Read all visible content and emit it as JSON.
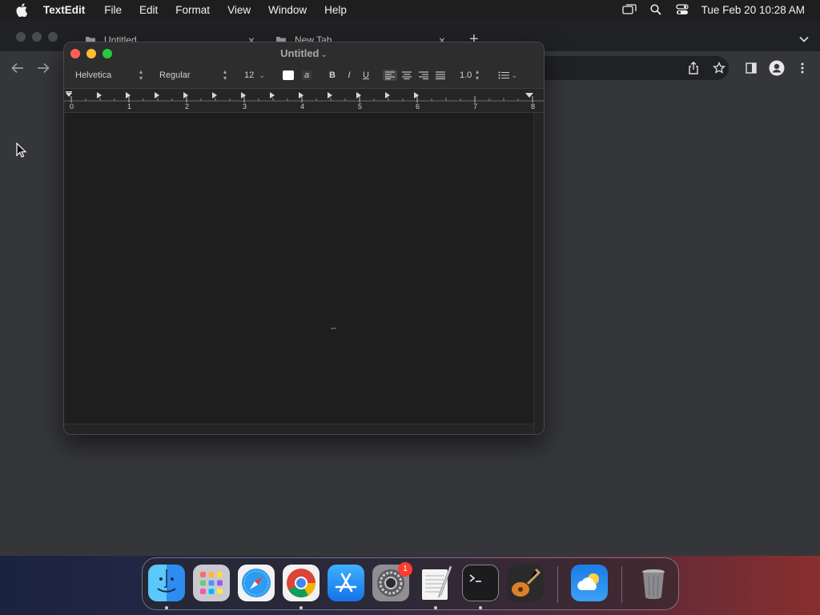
{
  "menubar": {
    "app_name": "TextEdit",
    "items": [
      "File",
      "Edit",
      "Format",
      "View",
      "Window",
      "Help"
    ],
    "clock": "Tue Feb 20  10:28 AM"
  },
  "browser": {
    "tabs": [
      {
        "label": "Untitled"
      },
      {
        "label": "New Tab"
      }
    ]
  },
  "textedit": {
    "title": "Untitled",
    "font_family": "Helvetica",
    "font_style": "Regular",
    "font_size": "12",
    "line_spacing": "1.0",
    "bold": "B",
    "italic": "I",
    "underline": "U",
    "text_color_glyph": "a",
    "ruler_numbers": [
      "0",
      "1",
      "2",
      "3",
      "4",
      "5",
      "6",
      "7",
      "8"
    ],
    "document_text": "--"
  },
  "dock": {
    "items": [
      "Finder",
      "Launchpad",
      "Safari",
      "Google Chrome",
      "App Store",
      "System Settings",
      "TextEdit",
      "Terminal",
      "GarageBand",
      "Weather",
      "Trash"
    ],
    "settings_badge": "1"
  },
  "colors": {
    "close": "#ff5f57",
    "minimize": "#febc2e",
    "zoom": "#28c840",
    "badge": "#ff3b30"
  }
}
